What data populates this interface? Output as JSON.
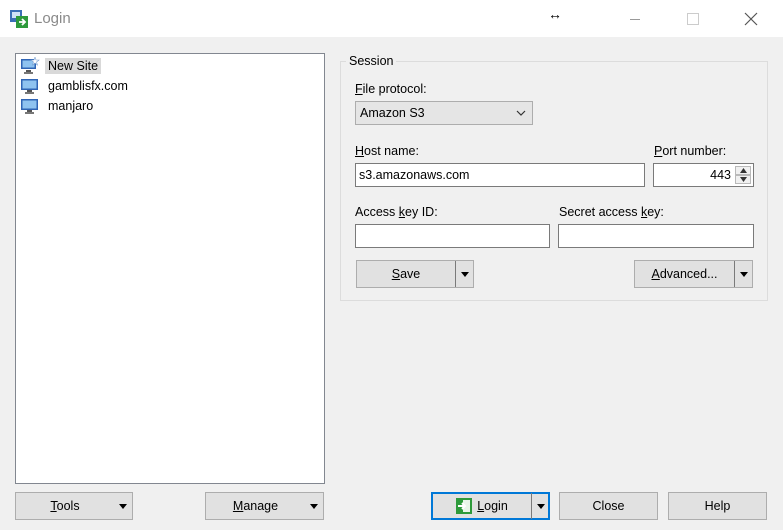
{
  "window": {
    "title": "Login",
    "resize_glyph": "↔",
    "icons": {
      "app": "winscp-app-icon",
      "minimize": "minimize-icon",
      "maximize": "maximize-icon",
      "close": "close-icon"
    }
  },
  "sites": {
    "items": [
      {
        "label": "New Site",
        "icon": "new-site-monitor-icon",
        "selected": true
      },
      {
        "label": "gamblisfx.com",
        "icon": "monitor-icon",
        "selected": false
      },
      {
        "label": "manjaro",
        "icon": "monitor-icon",
        "selected": false
      }
    ]
  },
  "session": {
    "group_title": "Session",
    "file_protocol": {
      "label_first": "F",
      "label_rest": "ile protocol:",
      "value": "Amazon S3"
    },
    "host_name": {
      "label_first": "H",
      "label_rest": "ost name:",
      "value": "s3.amazonaws.com"
    },
    "port_number": {
      "label_first": "P",
      "label_rest": "ort number:",
      "value": "443"
    },
    "access_key_id": {
      "label_pre": "Access ",
      "label_ul": "k",
      "label_post": "ey ID:",
      "value": ""
    },
    "secret_access_key": {
      "label_pre": "Secret access ",
      "label_ul": "k",
      "label_post": "ey:",
      "value": ""
    },
    "save_button": {
      "label_first": "S",
      "label_rest": "ave"
    },
    "advanced_button": {
      "label_pre": "",
      "label_ul": "A",
      "label_post": "dvanced..."
    }
  },
  "bottom": {
    "tools_button": {
      "label_first": "T",
      "label_rest": "ools"
    },
    "manage_button": {
      "label_first": "M",
      "label_rest": "anage"
    },
    "login_button": {
      "label_first": "L",
      "label_rest": "ogin",
      "icon": "login-icon"
    },
    "close_button": {
      "label": "Close"
    },
    "help_button": {
      "label": "Help"
    }
  }
}
